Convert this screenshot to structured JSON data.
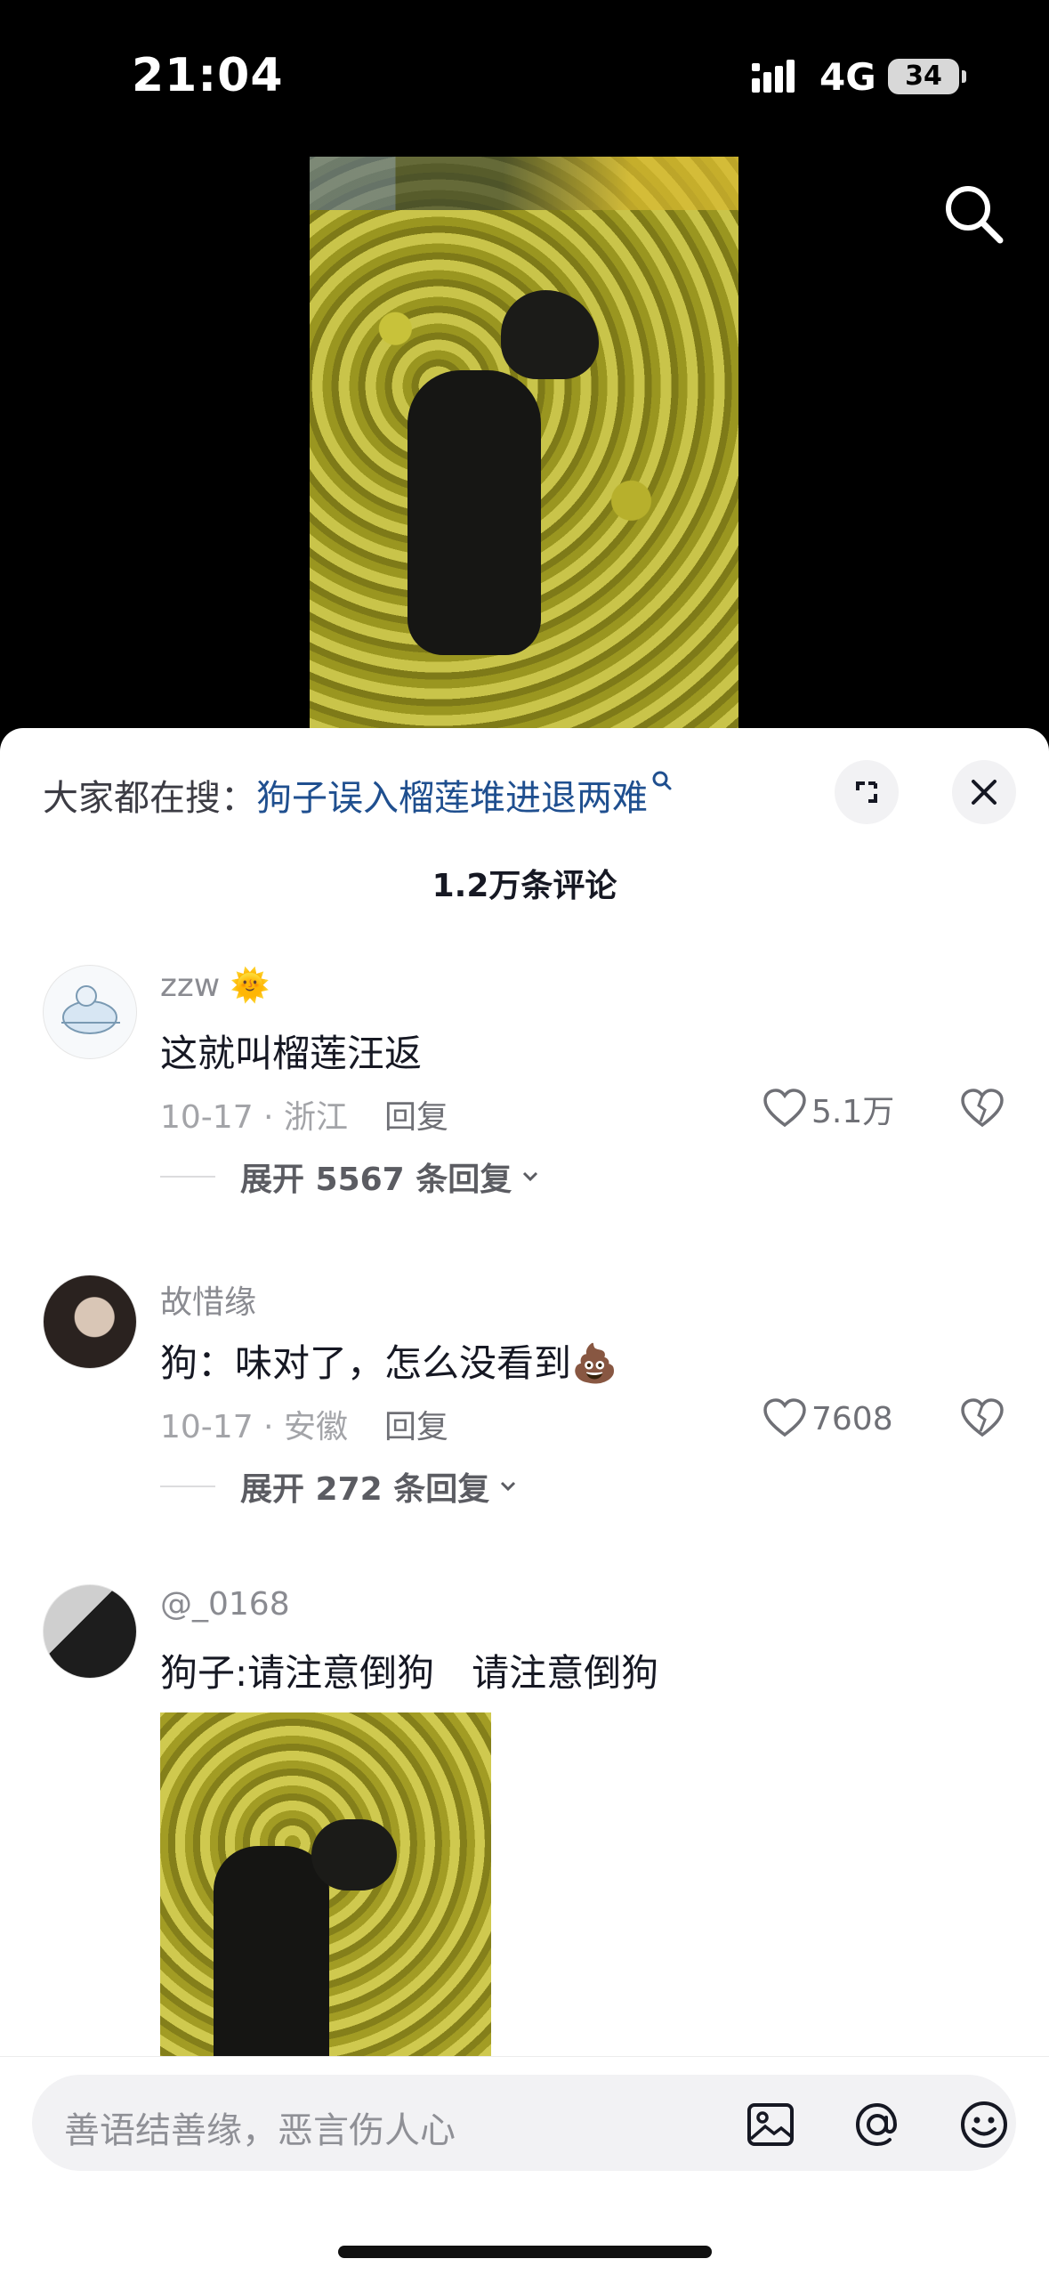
{
  "status_bar": {
    "time": "21:04",
    "network": "4G",
    "battery": "34"
  },
  "video": {
    "search_icon": "search-icon"
  },
  "sheet": {
    "search_prefix": "大家都在搜：",
    "search_query": "狗子误入榴莲堆进退两难",
    "comment_count": "1.2万条评论",
    "expand_icon": "expand-icon",
    "close_icon": "close-icon"
  },
  "comments": [
    {
      "name": "zzw",
      "name_emoji": "🌞",
      "text": "这就叫榴莲汪返",
      "meta": "10-17 · 浙江",
      "reply": "回复",
      "likes": "5.1万",
      "expand": "展开 5567 条回复"
    },
    {
      "name": "故惜缘",
      "text": "狗：味对了，怎么没看到💩",
      "meta": "10-17 · 安徽",
      "reply": "回复",
      "likes": "7608",
      "expand": "展开 272 条回复"
    },
    {
      "name": "@_0168",
      "text": "狗子:请注意倒狗　请注意倒狗"
    }
  ],
  "input": {
    "placeholder": "善语结善缘，恶言伤人心",
    "icons": [
      "image-icon",
      "at-icon",
      "emoji-icon"
    ]
  }
}
